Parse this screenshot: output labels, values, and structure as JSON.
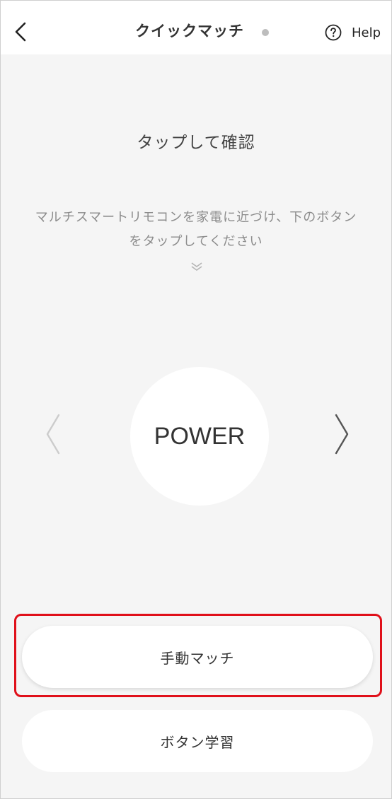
{
  "header": {
    "title": "クイックマッチ",
    "help_label": "Help",
    "status_dot_color": "#bdbdbd"
  },
  "main": {
    "heading": "タップして確認",
    "instruction": "マルチスマートリモコンを家電に近づけ、下のボタンをタップしてください",
    "key_label": "POWER"
  },
  "actions": {
    "manual_match_label": "手動マッチ",
    "button_learning_label": "ボタン学習"
  },
  "highlight_color": "#e0101a",
  "icons": {
    "back": "chevron-left-icon",
    "help": "question-circle-icon",
    "hint": "double-chevron-down-icon",
    "prev": "chevron-left-thin-icon",
    "next": "chevron-right-thin-icon"
  }
}
